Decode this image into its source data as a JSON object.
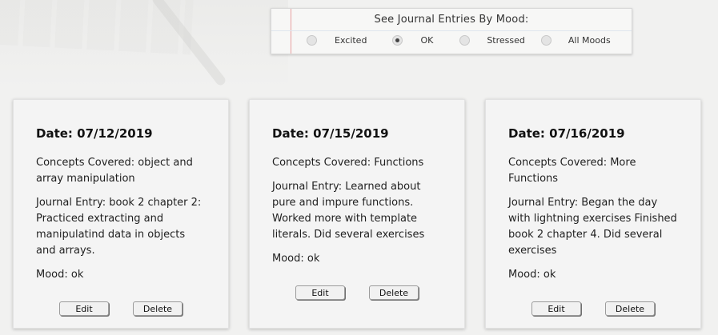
{
  "filter": {
    "title": "See Journal Entries By Mood:",
    "options": [
      {
        "label": "Excited",
        "checked": false
      },
      {
        "label": "OK",
        "checked": true
      },
      {
        "label": "Stressed",
        "checked": false
      },
      {
        "label": "All Moods",
        "checked": false
      }
    ]
  },
  "entries": [
    {
      "date": "Date: 07/12/2019",
      "concepts": "Concepts Covered: object and array manipulation",
      "journal": "Journal Entry: book 2 chapter 2: Practiced extracting and manipulatind data in objects and arrays.",
      "mood": "Mood: ok",
      "edit_label": "Edit",
      "delete_label": "Delete"
    },
    {
      "date": "Date: 07/15/2019",
      "concepts": "Concepts Covered: Functions",
      "journal": "Journal Entry: Learned about pure and impure functions. Worked more with template literals. Did several exercises",
      "mood": "Mood: ok",
      "edit_label": "Edit",
      "delete_label": "Delete"
    },
    {
      "date": "Date: 07/16/2019",
      "concepts": "Concepts Covered: More Functions",
      "journal": "Journal Entry: Began the day with lightning exercises Finished book 2 chapter 4. Did several exercises",
      "mood": "Mood: ok",
      "edit_label": "Edit",
      "delete_label": "Delete"
    }
  ]
}
